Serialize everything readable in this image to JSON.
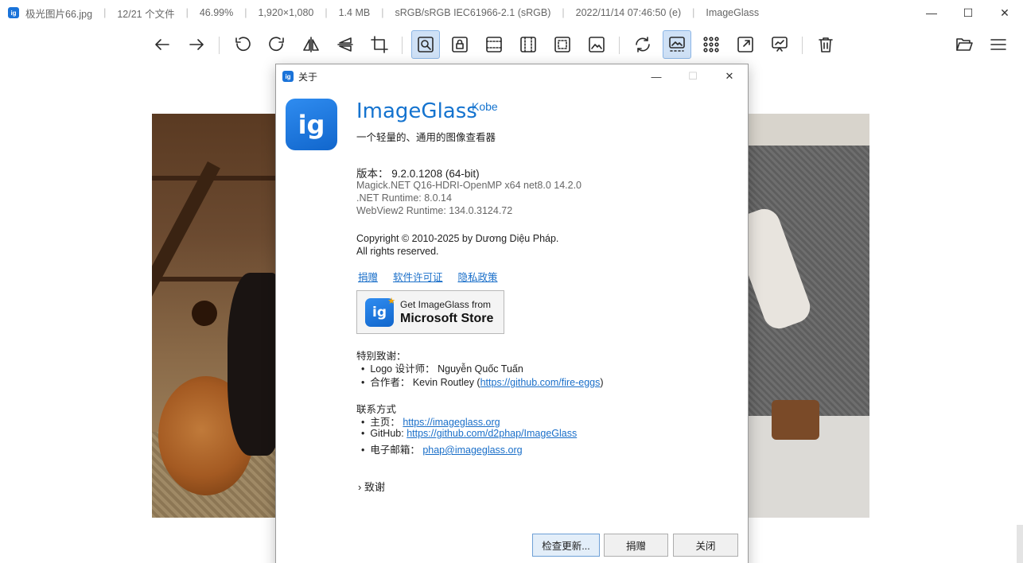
{
  "titlebar": {
    "filename": "极光图片66.jpg",
    "index": "12/21 个文件",
    "zoom": "46.99%",
    "dimensions": "1,920×1,080",
    "filesize": "1.4 MB",
    "colorspace": "sRGB/sRGB IEC61966-2.1 (sRGB)",
    "datetime": "2022/11/14 07:46:50 (e)",
    "appname": "ImageGlass",
    "minimize": "—",
    "maximize": "☐",
    "close": "✕"
  },
  "toolbar": {
    "items": [
      "back",
      "forward",
      "rotate-left",
      "rotate-right",
      "flip-horizontal",
      "flip-vertical",
      "crop",
      "auto-zoom",
      "lock-zoom",
      "scale-to-width",
      "scale-to-height",
      "scale-to-fit",
      "scale-to-fill",
      "refresh",
      "gallery",
      "thumbnail-grid",
      "fullscreen",
      "slideshow",
      "delete",
      "open-file",
      "menu"
    ]
  },
  "dialog": {
    "title": "关于",
    "minimize": "—",
    "maximize": "☐",
    "close": "✕",
    "logo_text": "ig",
    "app_name": "ImageGlass",
    "edition": "Kobe",
    "tagline": "一个轻量的、通用的图像查看器",
    "version_label": "版本：",
    "version_value": "9.2.0.1208 (64-bit)",
    "magick": "Magick.NET Q16-HDRI-OpenMP x64 net8.0 14.2.0",
    "dotnet": ".NET Runtime: 8.0.14",
    "webview": "WebView2 Runtime: 134.0.3124.72",
    "copyright": "Copyright © 2010-2025 by Dương Diệu Pháp.",
    "rights": "All rights reserved.",
    "links": {
      "donate": "捐赠",
      "license": "软件许可证",
      "privacy": "隐私政策"
    },
    "store": {
      "logo_text": "ig",
      "top": "Get ImageGlass from",
      "bottom": "Microsoft Store"
    },
    "thanks_title": "特别致谢：",
    "logo_designer_label": "Logo 设计师：",
    "logo_designer_name": "Nguyễn Quốc Tuấn",
    "collaborator_label": "合作者：",
    "collaborator_name": "Kevin Routley (",
    "collaborator_link": "https://github.com/fire-eggs",
    "collaborator_close": ")",
    "contact_title": "联系方式",
    "homepage_label": "主页：",
    "homepage_link": "https://imageglass.org",
    "github_label": "GitHub:",
    "github_link": "https://github.com/d2phap/ImageGlass",
    "email_label": "电子邮箱：",
    "email_link": "phap@imageglass.org",
    "credits_toggle": "致谢",
    "buttons": {
      "check_update": "检查更新...",
      "donate": "捐赠",
      "close": "关闭"
    }
  }
}
